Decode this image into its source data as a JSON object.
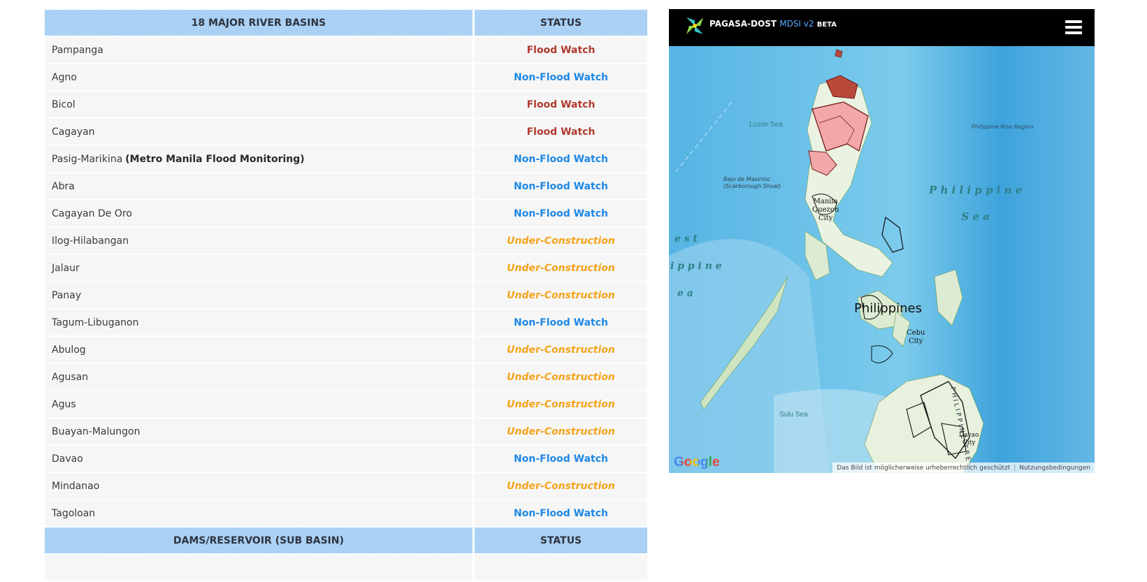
{
  "table": {
    "header": {
      "basins": "18 MAJOR RIVER BASINS",
      "status": "STATUS"
    },
    "rows": [
      {
        "name": "Pampanga",
        "status": "Flood Watch",
        "type": "flood"
      },
      {
        "name": "Agno",
        "status": "Non-Flood Watch",
        "type": "nonflood"
      },
      {
        "name": "Bicol",
        "status": "Flood Watch",
        "type": "flood"
      },
      {
        "name": "Cagayan",
        "status": "Flood Watch",
        "type": "flood"
      },
      {
        "name": "Pasig-Marikina",
        "suffix": "(Metro Manila Flood Monitoring)",
        "status": "Non-Flood Watch",
        "type": "nonflood"
      },
      {
        "name": "Abra",
        "status": "Non-Flood Watch",
        "type": "nonflood"
      },
      {
        "name": "Cagayan De Oro",
        "status": "Non-Flood Watch",
        "type": "nonflood"
      },
      {
        "name": "Ilog-Hilabangan",
        "status": "Under-Construction",
        "type": "construction"
      },
      {
        "name": "Jalaur",
        "status": "Under-Construction",
        "type": "construction"
      },
      {
        "name": "Panay",
        "status": "Under-Construction",
        "type": "construction"
      },
      {
        "name": "Tagum-Libuganon",
        "status": "Non-Flood Watch",
        "type": "nonflood"
      },
      {
        "name": "Abulog",
        "status": "Under-Construction",
        "type": "construction"
      },
      {
        "name": "Agusan",
        "status": "Under-Construction",
        "type": "construction"
      },
      {
        "name": "Agus",
        "status": "Under-Construction",
        "type": "construction"
      },
      {
        "name": "Buayan-Malungon",
        "status": "Under-Construction",
        "type": "construction"
      },
      {
        "name": "Davao",
        "status": "Non-Flood Watch",
        "type": "nonflood"
      },
      {
        "name": "Mindanao",
        "status": "Under-Construction",
        "type": "construction"
      },
      {
        "name": "Tagoloan",
        "status": "Non-Flood Watch",
        "type": "nonflood"
      }
    ],
    "footer_header": {
      "basins": "DAMS/RESERVOIR (SUB BASIN)",
      "status": "STATUS"
    }
  },
  "colors": {
    "flood": "#b03a2e",
    "nonflood": "#1e88e5",
    "construction": "#f5a31a",
    "header_bg": "#a4cdf4"
  },
  "map": {
    "brand": {
      "name": "PAGASA-DOST",
      "version": "MDSI v2",
      "beta": "BETA"
    },
    "menu_icon": "hamburger-menu-icon",
    "labels": {
      "luzon_sea": "Luzon Sea",
      "rise_region": "Philippine Rise Region",
      "bajo1": "Bajo de Masinloc",
      "bajo2": "(Scarborough Shoal)",
      "ph_sea_1": "P h i l i p p i n e",
      "ph_sea_2": "S e a",
      "west_1": "e s t",
      "west_2": "i p p i n e",
      "west_3": "e a",
      "manila": "Manila",
      "quezon1": "Quezon",
      "quezon2": "City",
      "country": "Philippines",
      "cebu1": "Cebu",
      "cebu2": "City",
      "sulu": "Sulu Sea",
      "trench": "PHILIPPINE TRENCH",
      "davao1": "Davao",
      "davao2": "City"
    },
    "google": "Google",
    "copyright": "Das Bild ist möglicherweise urheberrechtlich geschützt",
    "terms": "Nutzungsbedingungen"
  }
}
